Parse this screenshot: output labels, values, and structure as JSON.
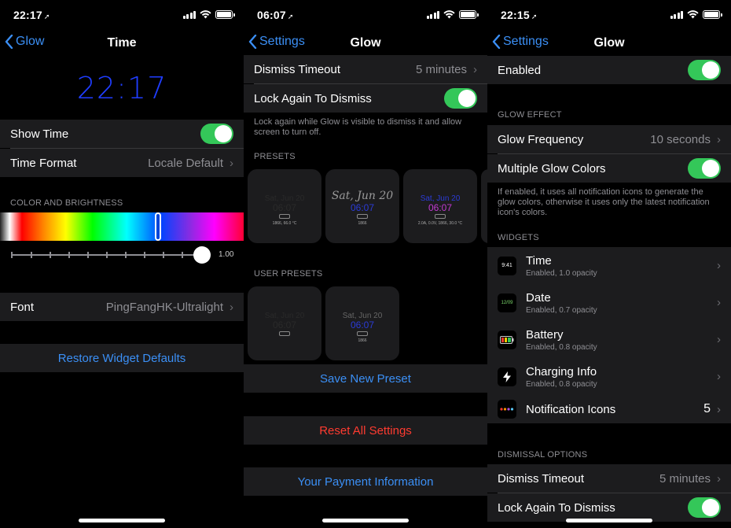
{
  "status": {
    "p1_time": "22:17",
    "p2_time": "06:07",
    "p3_time": "22:15"
  },
  "p1": {
    "back_label": "Glow",
    "title": "Time",
    "clock": "22:17",
    "show_time_label": "Show Time",
    "time_format_label": "Time Format",
    "time_format_value": "Locale Default",
    "color_header": "COLOR AND BRIGHTNESS",
    "brightness_value": "1.00",
    "font_label": "Font",
    "font_value": "PingFangHK-Ultralight",
    "restore_label": "Restore Widget Defaults"
  },
  "p2": {
    "back_label": "Settings",
    "title": "Glow",
    "dismiss_timeout_label": "Dismiss Timeout",
    "dismiss_timeout_value": "5 minutes",
    "lock_again_label": "Lock Again To Dismiss",
    "lock_footnote": "Lock again while Glow is visible to dismiss it and allow screen to turn off.",
    "presets_header": "PRESETS",
    "presets": [
      {
        "date": "Sat, Jun 20",
        "time": "06:07",
        "sub": "1866, 66.0 °C"
      },
      {
        "date": "Sat, Jun 20",
        "time": "06:07",
        "sub": "1866"
      },
      {
        "date": "Sat, Jun 20",
        "time": "06:07",
        "sub": "2.0A, 0.0V, 1866, 30.0 °C"
      }
    ],
    "user_presets_header": "USER PRESETS",
    "user_presets": [
      {
        "date": "Sat, Jun 20",
        "time": "06:07"
      },
      {
        "date": "Sat, Jun 20",
        "time": "06:07",
        "sub": "1866"
      }
    ],
    "save_preset_label": "Save New Preset",
    "reset_label": "Reset All Settings",
    "payment_label": "Your Payment Information"
  },
  "p3": {
    "back_label": "Settings",
    "title": "Glow",
    "enabled_label": "Enabled",
    "glow_effect_header": "GLOW EFFECT",
    "glow_frequency_label": "Glow Frequency",
    "glow_frequency_value": "10 seconds",
    "multi_colors_label": "Multiple Glow Colors",
    "multi_colors_footnote": "If enabled, it uses all notification icons to generate the glow colors, otherwise it uses only the latest notification icon's colors.",
    "widgets_header": "WIDGETS",
    "widgets": [
      {
        "icon": "9:41",
        "title": "Time",
        "sub": "Enabled, 1.0 opacity"
      },
      {
        "icon": "12/09",
        "title": "Date",
        "sub": "Enabled, 0.7 opacity"
      },
      {
        "icon": "battery",
        "title": "Battery",
        "sub": "Enabled, 0.8 opacity"
      },
      {
        "icon": "bolt",
        "title": "Charging Info",
        "sub": "Enabled, 0.8 opacity"
      }
    ],
    "notif_icons_label": "Notification Icons",
    "notif_icons_value": "5",
    "dismissal_header": "DISMISSAL OPTIONS",
    "dismiss_timeout_label": "Dismiss Timeout",
    "dismiss_timeout_value": "5 minutes",
    "lock_again_label": "Lock Again To Dismiss"
  },
  "colors": {
    "accent": "#3b8ff5",
    "toggle_on": "#34c759",
    "destructive": "#ff3b30",
    "clock_blue": "#1f3dff"
  }
}
